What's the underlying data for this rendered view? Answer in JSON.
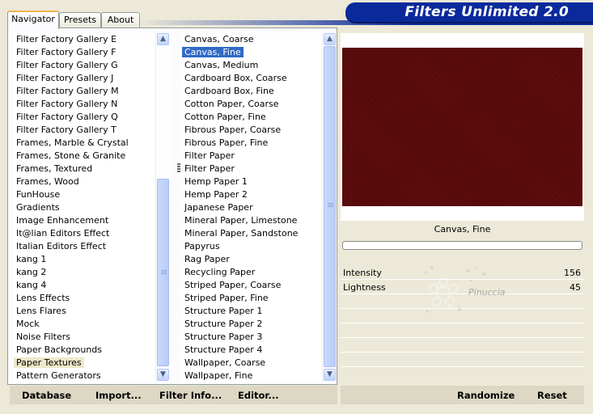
{
  "window": {
    "title": "Filters Unlimited 2.0"
  },
  "tabs": [
    {
      "label": "Navigator",
      "active": true
    },
    {
      "label": "Presets",
      "active": false
    },
    {
      "label": "About",
      "active": false
    }
  ],
  "categories": {
    "items": [
      "Filter Factory Gallery E",
      "Filter Factory Gallery F",
      "Filter Factory Gallery G",
      "Filter Factory Gallery J",
      "Filter Factory Gallery M",
      "Filter Factory Gallery N",
      "Filter Factory Gallery Q",
      "Filter Factory Gallery T",
      "Frames, Marble & Crystal",
      "Frames, Stone & Granite",
      "Frames, Textured",
      "Frames, Wood",
      "FunHouse",
      "Gradients",
      "Image Enhancement",
      "It@lian Editors Effect",
      "Italian Editors Effect",
      "kang 1",
      "kang 2",
      "kang 4",
      "Lens Effects",
      "Lens Flares",
      "Mock",
      "Noise Filters",
      "Paper Backgrounds",
      "Paper Textures",
      "Pattern Generators"
    ],
    "highlighted": "Paper Textures"
  },
  "filters": {
    "items": [
      "Canvas, Coarse",
      "Canvas, Fine",
      "Canvas, Medium",
      "Cardboard Box, Coarse",
      "Cardboard Box, Fine",
      "Cotton Paper, Coarse",
      "Cotton Paper, Fine",
      "Fibrous Paper, Coarse",
      "Fibrous Paper, Fine",
      "Filter Paper",
      "Filter Paper",
      "Hemp Paper 1",
      "Hemp Paper 2",
      "Japanese Paper",
      "Mineral Paper, Limestone",
      "Mineral Paper, Sandstone",
      "Papyrus",
      "Rag Paper",
      "Recycling Paper",
      "Striped Paper, Coarse",
      "Striped Paper, Fine",
      "Structure Paper 1",
      "Structure Paper 2",
      "Structure Paper 3",
      "Structure Paper 4",
      "Wallpaper, Coarse",
      "Wallpaper, Fine"
    ],
    "selected": "Canvas, Fine"
  },
  "preview": {
    "filter_name": "Canvas, Fine",
    "color": "#5a0a0a"
  },
  "params": [
    {
      "label": "Intensity",
      "value": "156"
    },
    {
      "label": "Lightness",
      "value": "45"
    }
  ],
  "watermark": {
    "text": "Pinuccia"
  },
  "buttons": {
    "database": "Database",
    "import": "Import...",
    "filter_info": "Filter Info...",
    "editor": "Editor...",
    "randomize": "Randomize",
    "reset": "Reset"
  },
  "icons": {
    "scroll_up": "scroll-up-arrow-icon",
    "scroll_down": "scroll-down-arrow-icon"
  }
}
